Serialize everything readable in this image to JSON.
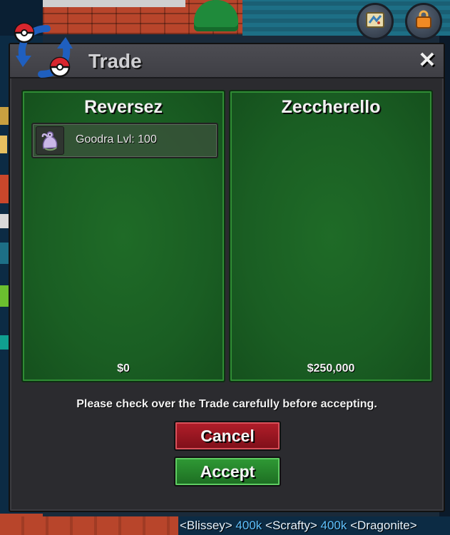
{
  "window": {
    "title": "Trade",
    "close_label": "✕"
  },
  "left_party": {
    "name": "Reversez",
    "money": "$0",
    "items": [
      {
        "label": "Goodra  Lvl: 100"
      }
    ]
  },
  "right_party": {
    "name": "Zeccherello",
    "money": "$250,000"
  },
  "notice": "Please check over the Trade carefully before accepting.",
  "buttons": {
    "cancel": "Cancel",
    "accept": "Accept"
  },
  "hud": {
    "map_icon": "map-icon",
    "shop_icon": "shop-bag-icon"
  },
  "chat_ticker": {
    "segments": [
      {
        "text": "<Blissey>",
        "tone": "white"
      },
      {
        "text": " 400k ",
        "tone": "blue"
      },
      {
        "text": "<Scrafty>",
        "tone": "white"
      },
      {
        "text": " 400k ",
        "tone": "blue"
      },
      {
        "text": "<Dragonite>",
        "tone": "white"
      }
    ]
  },
  "colors": {
    "panel_green": "#1a5e23",
    "cancel_red": "#b31e2a",
    "accept_green": "#2f9a35",
    "window_bg": "#2b2b2f"
  }
}
